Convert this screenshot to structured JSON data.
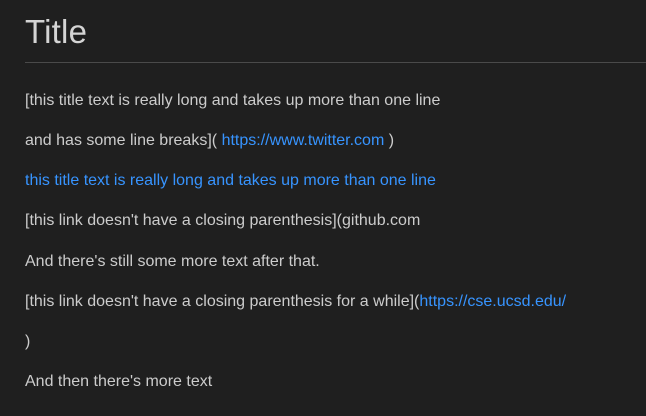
{
  "title": "Title",
  "colors": {
    "background": "#1f1f1f",
    "text": "#cccccc",
    "link": "#3794ff",
    "rule": "#4a4a4a"
  },
  "content": {
    "line1": "[this title text is really long and takes up more than one line",
    "line2_text": "and has some line breaks](",
    "line2_link": "https://www.twitter.com",
    "line2_after": ")",
    "line3_link": "this title text is really long and takes up more than one line",
    "line4": "[this link doesn't have a closing parenthesis](github.com",
    "line5": "And there's still some more text after that.",
    "line6_text": "[this link doesn't have a closing parenthesis for a while](",
    "line6_link": "https://cse.ucsd.edu/",
    "line7": ")",
    "line8": "And then there's more text"
  }
}
